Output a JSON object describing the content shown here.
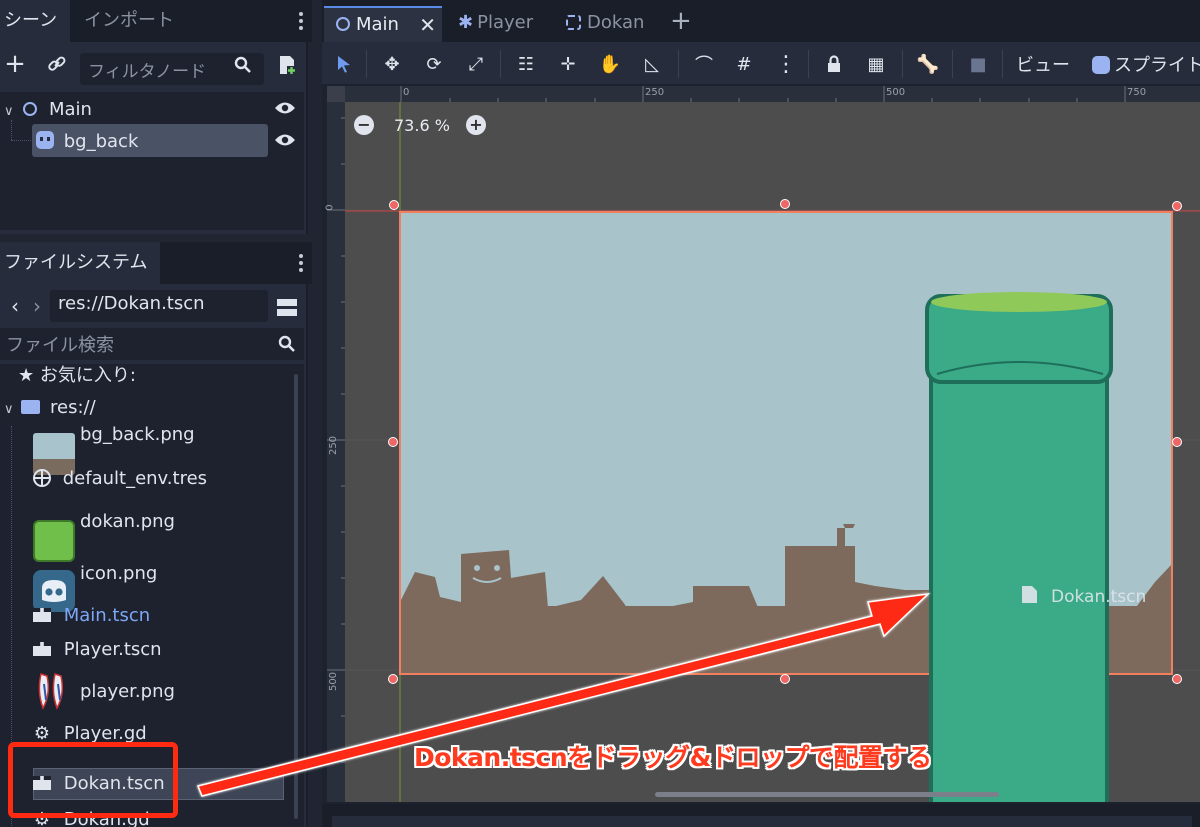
{
  "scene_dock": {
    "tabs": [
      "シーン",
      "インポート"
    ],
    "filter_placeholder": "フィルタノード",
    "tree": [
      {
        "label": "Main"
      },
      {
        "label": "bg_back"
      }
    ]
  },
  "filesystem_dock": {
    "tab": "ファイルシステム",
    "path": "res://Dokan.tscn",
    "search_placeholder": "ファイル検索",
    "favorites": "お気に入り:",
    "root": "res://",
    "files": [
      "bg_back.png",
      "default_env.tres",
      "dokan.png",
      "icon.png",
      "Main.tscn",
      "Player.tscn",
      "player.png",
      "Player.gd",
      "Dokan.tscn",
      "Dokan.gd"
    ]
  },
  "editor": {
    "tabs": [
      "Main",
      "Player",
      "Dokan"
    ],
    "toolbar": {
      "view_label": "ビュー",
      "sprite_label": "スプライト"
    },
    "zoom": "73.6 %",
    "ruler_top": [
      "0",
      "250",
      "500",
      "750"
    ],
    "ruler_left": [
      "0",
      "250",
      "500"
    ],
    "drag_preview": "Dokan.tscn"
  },
  "annotation": {
    "text": "Dokan.tscnをドラッグ&ドロップで配置する",
    "color": "#ff3b1f"
  }
}
